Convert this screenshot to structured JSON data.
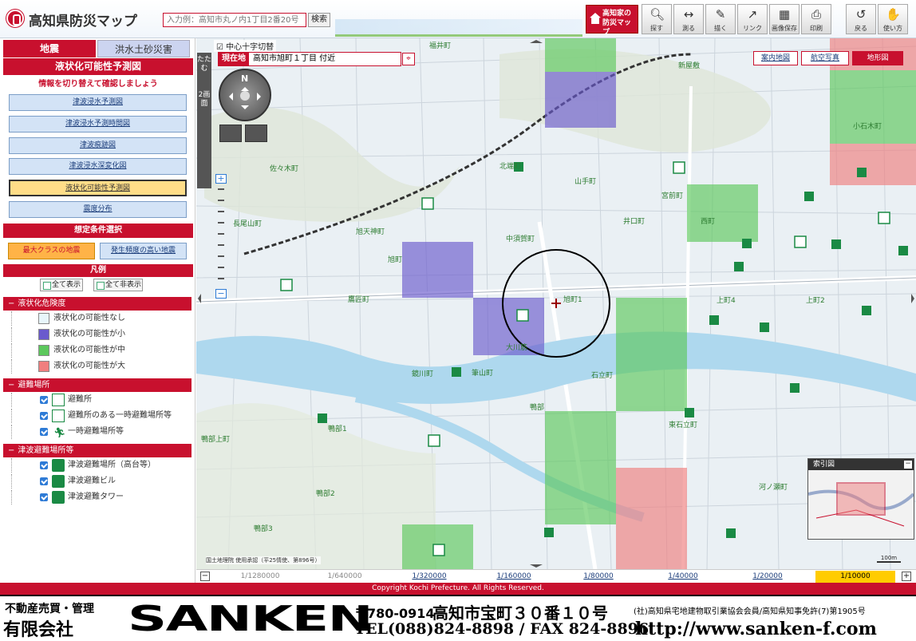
{
  "header": {
    "title": "高知県防災マップ",
    "search_placeholder": "入力例：高知市丸ノ内1丁目2番20号",
    "search_button": "検索",
    "bosai_button": "高知家の防災マップ",
    "tools": [
      {
        "label": "探す",
        "icon": "magnifier-icon"
      },
      {
        "label": "測る",
        "icon": "ruler-icon"
      },
      {
        "label": "描く",
        "icon": "pen-icon"
      },
      {
        "label": "リンク",
        "icon": "link-icon"
      },
      {
        "label": "画像保存",
        "icon": "image-save-icon"
      },
      {
        "label": "印刷",
        "icon": "printer-icon"
      },
      {
        "label": "戻る",
        "icon": "back-icon"
      },
      {
        "label": "使い方",
        "icon": "help-icon"
      }
    ]
  },
  "left_panel": {
    "tabs": [
      "地震",
      "洪水土砂災害"
    ],
    "heading": "液状化可能性予測図",
    "instruction": "情報を切り替えて確認しましょう",
    "menu": [
      "津波浸水予測図",
      "津波浸水予測時間図",
      "津波痕跡図",
      "津波浸水深変化図",
      "液状化可能性予測図",
      "震度分布"
    ],
    "selected_menu": "液状化可能性予測図",
    "condition_heading": "想定条件選択",
    "conditions": [
      "最大クラスの地震",
      "発生頻度の高い地震"
    ],
    "legend_heading": "凡例",
    "show_all": "全て表示",
    "hide_all": "全て非表示",
    "sections": [
      {
        "title": "液状化危険度",
        "items": [
          {
            "label": "液状化の可能性なし",
            "color": "#e8f6fb"
          },
          {
            "label": "液状化の可能性が小",
            "color": "#6a5acd"
          },
          {
            "label": "液状化の可能性が中",
            "color": "#5cc85c"
          },
          {
            "label": "液状化の可能性が大",
            "color": "#f07f7f"
          }
        ]
      },
      {
        "title": "避難場所",
        "items": [
          {
            "label": "避難所"
          },
          {
            "label": "避難所のある一時避難場所等"
          },
          {
            "label": "一時避難場所等"
          }
        ]
      },
      {
        "title": "津波避難場所等",
        "items": [
          {
            "label": "津波避難場所（高台等）"
          },
          {
            "label": "津波避難ビル"
          },
          {
            "label": "津波避難タワー"
          }
        ]
      }
    ]
  },
  "map": {
    "crosshair_label": "中心十字切替",
    "side_toggle": "たたむ",
    "side_toggle2": "2画面",
    "location_key": "現在地",
    "location_value": "高知市旭町１丁目 付近",
    "map_types": [
      "案内地図",
      "航空写真",
      "地形図"
    ],
    "active_map_type": "地形図",
    "index_title": "索引図",
    "attribution": "国土地理院 使用承認（平25情使、第896号）",
    "scale_bar": "100m",
    "place_labels": [
      "福井町",
      "佐々木町",
      "長尾山町",
      "旭天神町",
      "旭町",
      "北端町",
      "山手町",
      "宮前町",
      "井口町",
      "中須賀町",
      "大川筋",
      "旭町1",
      "鏡川町",
      "鴨部上町",
      "鴨部1",
      "鴨部2",
      "鴨部3",
      "鷹匠町",
      "石立町",
      "東石立町",
      "筆山町",
      "新屋敷",
      "西町",
      "小石木町",
      "上町4",
      "上町2",
      "河ノ瀬町",
      "鴨部"
    ],
    "liquefaction_colors": {
      "small": "#6a5acd",
      "medium": "#5cc85c",
      "large": "#f07f7f"
    },
    "scales": [
      "1/1280000",
      "1/640000",
      "1/320000",
      "1/160000",
      "1/80000",
      "1/40000",
      "1/20000",
      "1/10000"
    ],
    "active_scale": "1/10000"
  },
  "footer": {
    "copyright": "Copyright Kochi Prefecture. All Rights Reserved."
  },
  "ad": {
    "kind": "不動産売買・管理",
    "company_type": "有限会社",
    "brand": "SANKEN",
    "zip": "〒780-0914",
    "address": "高知市宝町３０番１０号",
    "tel": "TEL(088)824-8898 / FAX 824-8896",
    "association": "(社)高知県宅地建物取引業協会会員/高知県知事免許(7)第1905号",
    "url": "http://www.sanken-f.com"
  }
}
